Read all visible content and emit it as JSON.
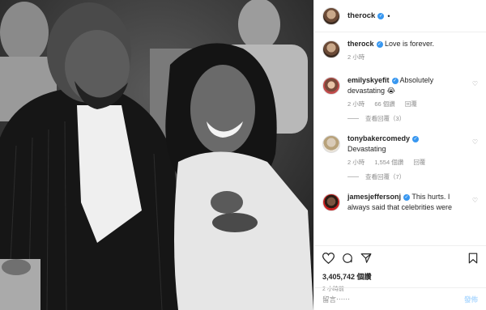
{
  "header": {
    "username": "therock",
    "dot": "•"
  },
  "caption": {
    "username": "therock",
    "text": "Love is forever.",
    "time": "2 小時"
  },
  "comments": [
    {
      "username": "emilyskyefit",
      "text": "Absolutely devastating 😭",
      "time": "2 小時",
      "likes": "66 個讚",
      "reply": "回覆",
      "replies": "查看回覆（3）"
    },
    {
      "username": "tonybakercomedy",
      "text": "Devastating",
      "time": "2 小時",
      "likes": "1,554 個讚",
      "reply": "回覆",
      "replies": "查看回覆（7）"
    },
    {
      "username": "jamesjeffersonj",
      "text": "This hurts. I always said that celebrities were"
    }
  ],
  "stats": {
    "likes": "3,405,742 個讚",
    "age": "2 小時前"
  },
  "composer": {
    "placeholder": "留言⋯⋯",
    "post": "發佈"
  },
  "icons": [
    "heart-icon",
    "comment-icon",
    "share-icon",
    "bookmark-icon",
    "verified-icon"
  ],
  "colors": {
    "verified": "#3897f0",
    "post_disabled": "#b3dbff",
    "meta": "#8e8e8e"
  }
}
